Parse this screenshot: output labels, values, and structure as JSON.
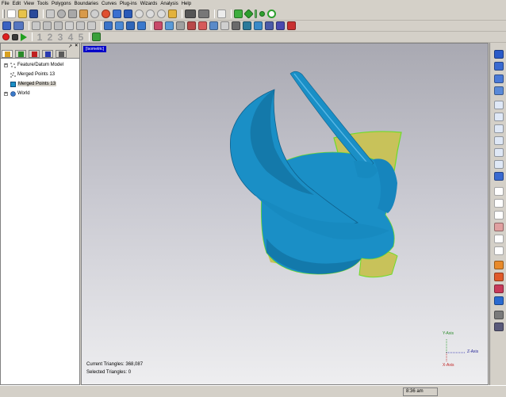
{
  "menu": [
    "File",
    "Edit",
    "View",
    "Tools",
    "Polygons",
    "Boundaries",
    "Curves",
    "Plug-ins",
    "Wizards",
    "Analysis",
    "Help"
  ],
  "toolbar3": {
    "steps": [
      "1",
      "2",
      "3",
      "4",
      "5"
    ]
  },
  "panel": {
    "pin_glyph": "↗",
    "close_glyph": "×",
    "tree": [
      {
        "label": "Feature/Datum Model",
        "selected": false
      },
      {
        "label": "Merged Points 13",
        "selected": false
      },
      {
        "label": "Merged Points 13",
        "selected": true
      },
      {
        "label": "World",
        "selected": false
      }
    ]
  },
  "viewport": {
    "view_label": "[Isometric]",
    "current_triangles": "Current Triangles: 368,087",
    "selected_triangles": "Selected Triangles: 0",
    "axes": {
      "y": "Y-Axis",
      "z": "Z-Axis",
      "x": "X-Axis"
    }
  },
  "status": {
    "time": "8:36 am"
  },
  "colors": {
    "model": "#1a8fc6",
    "model_dark": "#106a98",
    "backface": "#c8c25a",
    "edge": "#6fdc2a",
    "view_label_bg": "#0000c8"
  }
}
